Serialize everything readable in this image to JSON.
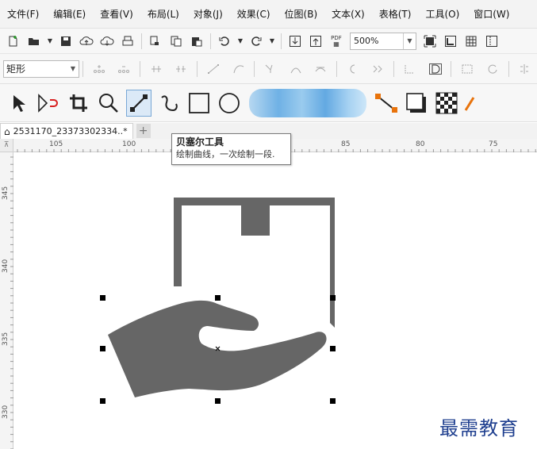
{
  "menu": [
    "文件(F)",
    "编辑(E)",
    "查看(V)",
    "布局(L)",
    "对象(J)",
    "效果(C)",
    "位图(B)",
    "文本(X)",
    "表格(T)",
    "工具(O)",
    "窗口(W)"
  ],
  "toolbar": {
    "zoom_value": "500%",
    "pdf_label": "PDF"
  },
  "property_bar": {
    "shape_type": "矩形"
  },
  "tabs": [
    {
      "label": "2531170_23373302334..*"
    }
  ],
  "ruler_top": [
    "105",
    "100",
    "85",
    "80",
    "75"
  ],
  "ruler_left": [
    "345",
    "340",
    "335",
    "330"
  ],
  "tooltip": {
    "title": "贝塞尔工具",
    "description": "绘制曲线，一次绘制一段."
  },
  "watermark": "最需教育",
  "colors": {
    "shape_fill": "#666666",
    "active_tool_bg": "#dbe9f7"
  }
}
